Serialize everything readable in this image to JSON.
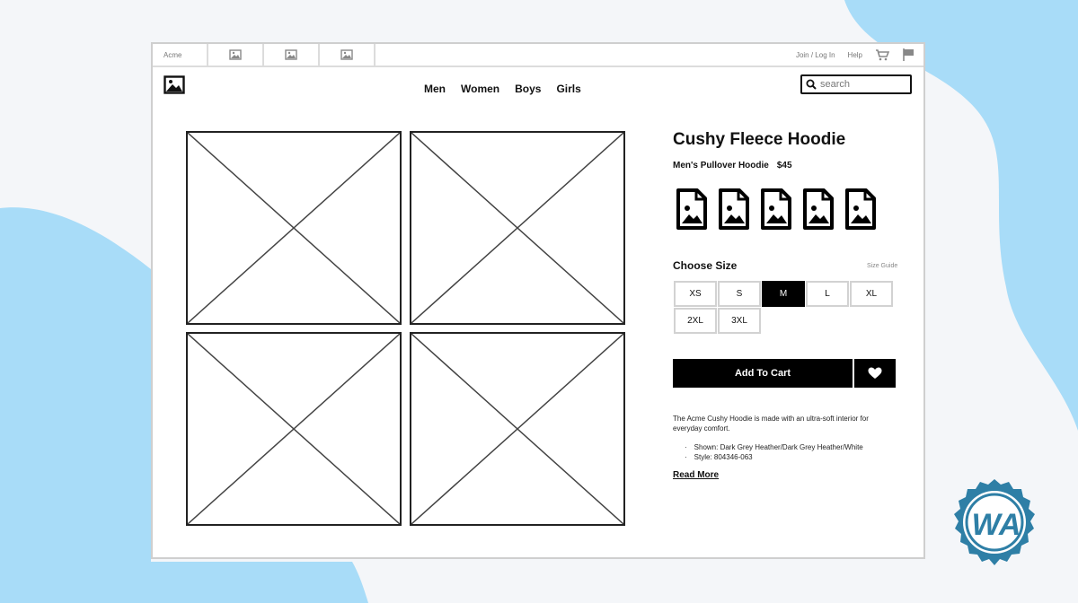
{
  "topbar": {
    "brand": "Acme",
    "image_tabs": [
      "image-icon",
      "image-icon",
      "image-icon"
    ],
    "join_label": "Join / Log In",
    "help_label": "Help",
    "cart_icon": "cart-icon",
    "flag_icon": "flag-icon"
  },
  "nav": {
    "logo_icon": "image-icon",
    "links": [
      "Men",
      "Women",
      "Boys",
      "Girls"
    ],
    "search_placeholder": "search",
    "search_icon": "search-icon"
  },
  "gallery": {
    "placeholders": [
      "image-placeholder",
      "image-placeholder",
      "image-placeholder",
      "image-placeholder"
    ]
  },
  "product": {
    "title": "Cushy Fleece Hoodie",
    "subtitle": "Men's Pullover Hoodie",
    "price": "$45",
    "color_swatches": [
      "file-image-icon",
      "file-image-icon",
      "file-image-icon",
      "file-image-icon",
      "file-image-icon"
    ],
    "choose_size_label": "Choose Size",
    "size_guide_label": "Size Guide",
    "sizes": [
      "XS",
      "S",
      "M",
      "L",
      "XL",
      "2XL",
      "3XL"
    ],
    "selected_size": "M",
    "add_to_cart_label": "Add To Cart",
    "favorite_icon": "heart-icon",
    "description": "The Acme Cushy Hoodie is made with an ultra-soft interior for everyday comfort.",
    "details": [
      "Shown: Dark Grey Heather/Dark Grey Heather/White",
      "Style: 804346-063"
    ],
    "read_more_label": "Read More"
  },
  "colors": {
    "background_blue": "#a8dcf8",
    "badge_blue": "#2e7fa6",
    "selected_size": "#000000"
  }
}
